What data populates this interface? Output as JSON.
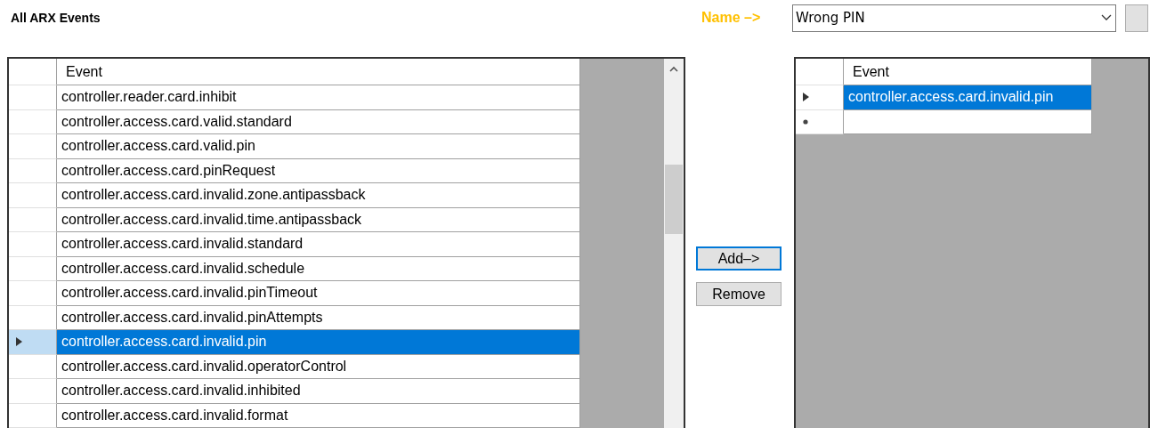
{
  "title": "All ARX Events",
  "name_label": "Name –>",
  "name_combo": {
    "value": "Wrong PIN"
  },
  "all_events": {
    "columns": [
      "Event"
    ],
    "rows": [
      {
        "event": "controller.reader.card.inhibit",
        "selected": false,
        "current": false
      },
      {
        "event": "controller.access.card.valid.standard",
        "selected": false,
        "current": false
      },
      {
        "event": "controller.access.card.valid.pin",
        "selected": false,
        "current": false
      },
      {
        "event": "controller.access.card.pinRequest",
        "selected": false,
        "current": false
      },
      {
        "event": "controller.access.card.invalid.zone.antipassback",
        "selected": false,
        "current": false
      },
      {
        "event": "controller.access.card.invalid.time.antipassback",
        "selected": false,
        "current": false
      },
      {
        "event": "controller.access.card.invalid.standard",
        "selected": false,
        "current": false
      },
      {
        "event": "controller.access.card.invalid.schedule",
        "selected": false,
        "current": false
      },
      {
        "event": "controller.access.card.invalid.pinTimeout",
        "selected": false,
        "current": false
      },
      {
        "event": "controller.access.card.invalid.pinAttempts",
        "selected": false,
        "current": false
      },
      {
        "event": "controller.access.card.invalid.pin",
        "selected": true,
        "current": true
      },
      {
        "event": "controller.access.card.invalid.operatorControl",
        "selected": false,
        "current": false
      },
      {
        "event": "controller.access.card.invalid.inhibited",
        "selected": false,
        "current": false
      },
      {
        "event": "controller.access.card.invalid.format",
        "selected": false,
        "current": false
      }
    ]
  },
  "buttons": [
    {
      "label": "Add–>",
      "focused": true
    },
    {
      "label": "Remove",
      "focused": false
    }
  ],
  "chosen_events": {
    "columns": [
      "Event"
    ],
    "rows": [
      {
        "event": "controller.access.card.invalid.pin",
        "selected": true,
        "current": true,
        "kind": "row"
      },
      {
        "kind": "new"
      }
    ]
  }
}
